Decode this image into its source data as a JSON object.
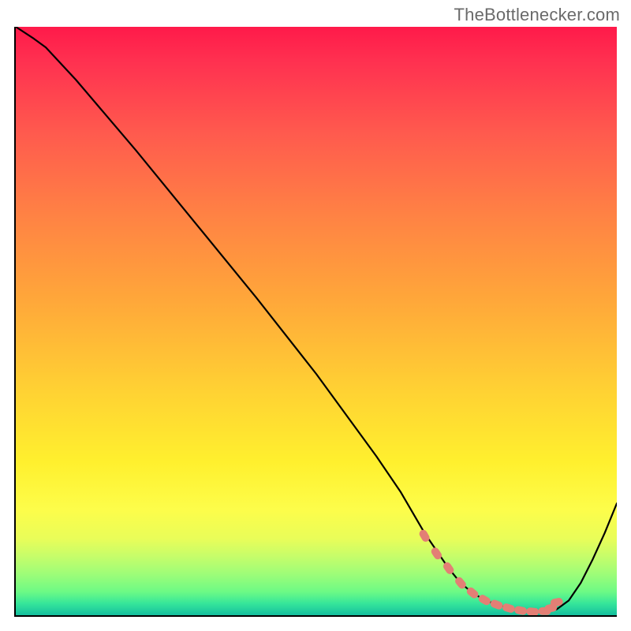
{
  "attribution": "TheBottlenecker.com",
  "chart_data": {
    "type": "line",
    "title": "",
    "xlabel": "",
    "ylabel": "",
    "xlim": [
      0,
      100
    ],
    "ylim": [
      0,
      100
    ],
    "series": [
      {
        "name": "bottleneck-curve",
        "x": [
          0,
          3,
          5,
          10,
          20,
          30,
          40,
          50,
          60,
          64,
          68,
          72,
          74,
          76,
          78,
          80,
          82,
          84,
          86,
          88,
          90,
          92,
          94,
          96,
          98,
          100
        ],
        "y": [
          100,
          98,
          96.5,
          91,
          79,
          66.5,
          54,
          41,
          27,
          21,
          14,
          8,
          5.5,
          3.8,
          2.6,
          1.8,
          1.2,
          0.8,
          0.6,
          0.6,
          1.0,
          2.5,
          5.5,
          9.5,
          14,
          19
        ]
      }
    ],
    "markers": {
      "name": "highlight-dots",
      "color": "#e37f75",
      "x": [
        68,
        70,
        72,
        74,
        76,
        78,
        80,
        82,
        84,
        86,
        88,
        89,
        90
      ],
      "y": [
        13.5,
        10.5,
        8,
        5.5,
        3.8,
        2.6,
        1.8,
        1.2,
        0.8,
        0.6,
        0.7,
        1.2,
        2.2
      ]
    },
    "gradient_stops": [
      {
        "pos": 0,
        "color": "#ff1a4a"
      },
      {
        "pos": 18,
        "color": "#ff5a4e"
      },
      {
        "pos": 46,
        "color": "#ffa63a"
      },
      {
        "pos": 74,
        "color": "#fff02e"
      },
      {
        "pos": 90,
        "color": "#c6fd6a"
      },
      {
        "pos": 100,
        "color": "#14be9e"
      }
    ]
  }
}
